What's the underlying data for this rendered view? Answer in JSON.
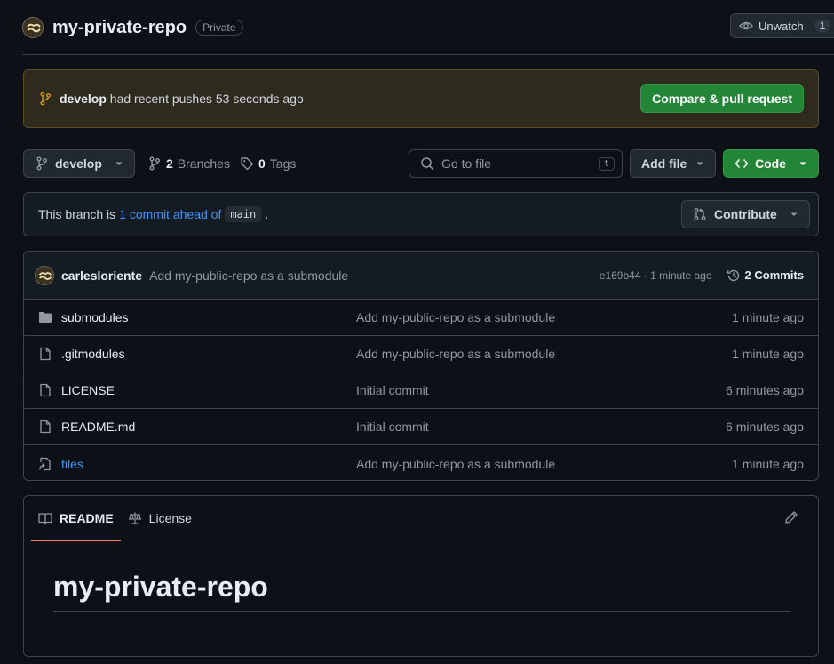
{
  "header": {
    "repo_name": "my-private-repo",
    "visibility": "Private",
    "watch_label": "Unwatch",
    "watch_count": "1"
  },
  "banner": {
    "branch": "develop",
    "text": "had recent pushes 53 seconds ago",
    "button": "Compare & pull request"
  },
  "toolbar": {
    "branch": "develop",
    "branches_count": "2",
    "branches_label": "Branches",
    "tags_count": "0",
    "tags_label": "Tags",
    "search_placeholder": "Go to file",
    "search_shortcut": "t",
    "add_file": "Add file",
    "code": "Code"
  },
  "branch_status": {
    "prefix": "This branch is",
    "link": "1 commit ahead of",
    "base": "main",
    "suffix": ".",
    "contribute": "Contribute"
  },
  "latest_commit": {
    "author": "carlesloriente",
    "message": "Add my-public-repo as a submodule",
    "meta": "e169b44 · 1 minute ago",
    "commits": "2 Commits"
  },
  "files": [
    {
      "name": "submodules",
      "icon": "folder-icon",
      "message": "Add my-public-repo as a submodule",
      "time": "1 minute ago"
    },
    {
      "name": ".gitmodules",
      "icon": "file-icon",
      "message": "Add my-public-repo as a submodule",
      "time": "1 minute ago"
    },
    {
      "name": "LICENSE",
      "icon": "file-icon",
      "message": "Initial commit",
      "time": "6 minutes ago"
    },
    {
      "name": "README.md",
      "icon": "file-icon",
      "message": "Initial commit",
      "time": "6 minutes ago"
    },
    {
      "name": "files",
      "icon": "symlink-icon",
      "message": "Add my-public-repo as a submodule",
      "time": "1 minute ago"
    }
  ],
  "readme": {
    "tabs": [
      "README",
      "License"
    ],
    "title": "my-private-repo"
  },
  "colors": {
    "background": "#0d1117",
    "accent_green": "#238636",
    "link_blue": "#4493f8",
    "tab_underline": "#f78166"
  }
}
